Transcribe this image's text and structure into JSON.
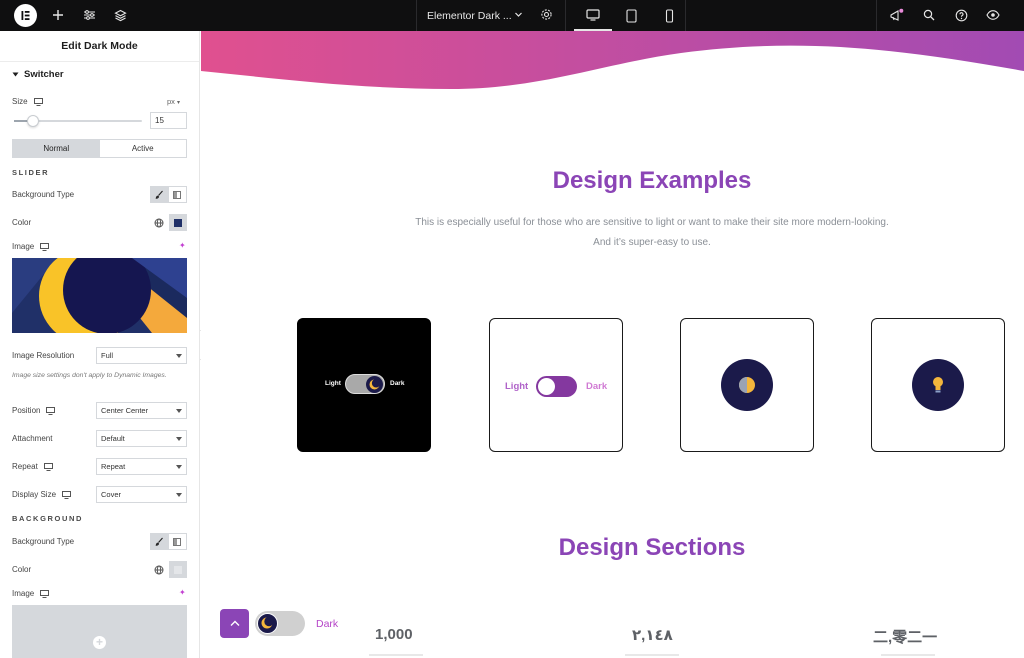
{
  "topbar": {
    "document_title": "Elementor Dark ...",
    "active_device": "desktop"
  },
  "panel": {
    "title": "Edit Dark Mode",
    "section_label": "Switcher",
    "size_label": "Size",
    "size_unit": "px",
    "size_value": "15",
    "size_slider_fraction": 0.15,
    "tabs": [
      "Normal",
      "Active"
    ],
    "active_tab": "Normal",
    "slider_group": {
      "heading": "SLIDER",
      "background_type_label": "Background Type",
      "color_label": "Color",
      "color_value": "#203068",
      "image_label": "Image",
      "image_resolution_label": "Image Resolution",
      "image_resolution_value": "Full",
      "note": "Image size settings don't apply to Dynamic Images.",
      "position_label": "Position",
      "position_value": "Center Center",
      "attachment_label": "Attachment",
      "attachment_value": "Default",
      "repeat_label": "Repeat",
      "repeat_value": "Repeat",
      "display_size_label": "Display Size",
      "display_size_value": "Cover"
    },
    "background_group": {
      "heading": "BACKGROUND",
      "background_type_label": "Background Type",
      "color_label": "Color",
      "image_label": "Image"
    }
  },
  "canvas": {
    "heading_examples": "Design Examples",
    "description_line1": "This is especially useful for those who are sensitive to light or want to make their site more modern-looking.",
    "description_line2": "And it’s super-easy to use.",
    "card1": {
      "light_label": "Light",
      "dark_label": "Dark"
    },
    "card2": {
      "light_label": "Light",
      "dark_label": "Dark"
    },
    "heading_sections": "Design Sections",
    "counters": [
      "1,000",
      "٢,١٤٨",
      "二,零二一"
    ],
    "floating_toggle_label": "Dark"
  },
  "colors": {
    "accent_purple": "#8b45b6",
    "wave_start": "#e0508f",
    "wave_end": "#a24bb3",
    "topbar_bg": "#0f0f10"
  }
}
